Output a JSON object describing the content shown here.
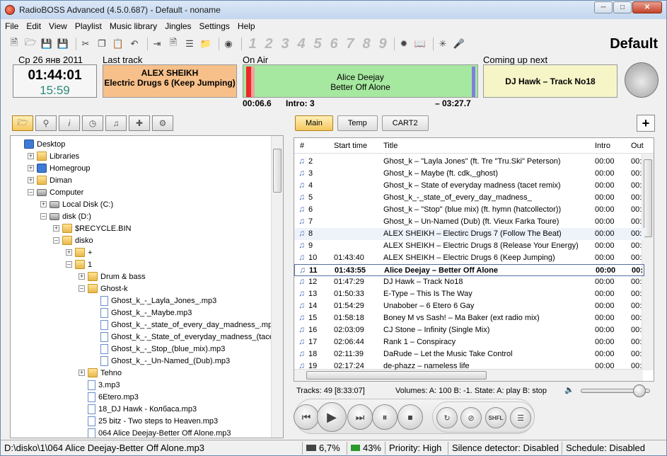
{
  "window": {
    "title": "RadioBOSS Advanced (4.5.0.687) - Default - noname",
    "profile": "Default"
  },
  "menu": [
    "File",
    "Edit",
    "View",
    "Playlist",
    "Music library",
    "Jingles",
    "Settings",
    "Help"
  ],
  "toolbar": {
    "numbers": [
      "1",
      "2",
      "3",
      "4",
      "5",
      "6",
      "7",
      "8",
      "9"
    ]
  },
  "info": {
    "date": "Ср 26 янв 2011",
    "clock_time": "01:44:01",
    "clock_sub": "15:59",
    "last_track_label": "Last track",
    "last_track": "ALEX SHEIKH\nElectric Drugs 6 (Keep Jumping)",
    "on_air_label": "On Air",
    "on_air": "Alice Deejay\nBetter Off Alone",
    "coming_next_label": "Coming up next",
    "coming_next": "DJ Hawk – Track No18",
    "elapsed": "00:06.6",
    "intro": "Intro: 3",
    "remaining": "– 03:27.7"
  },
  "tree": [
    {
      "label": "Desktop",
      "level": 0,
      "exp": "",
      "icon": "blue"
    },
    {
      "label": "Libraries",
      "level": 1,
      "exp": "+",
      "icon": "folder"
    },
    {
      "label": "Homegroup",
      "level": 1,
      "exp": "+",
      "icon": "blue"
    },
    {
      "label": "Diman",
      "level": 1,
      "exp": "+",
      "icon": "folder"
    },
    {
      "label": "Computer",
      "level": 1,
      "exp": "–",
      "icon": "drive"
    },
    {
      "label": "Local Disk (C:)",
      "level": 2,
      "exp": "+",
      "icon": "drive"
    },
    {
      "label": "disk (D:)",
      "level": 2,
      "exp": "–",
      "icon": "drive"
    },
    {
      "label": "$RECYCLE.BIN",
      "level": 3,
      "exp": "+",
      "icon": "folder"
    },
    {
      "label": "disko",
      "level": 3,
      "exp": "–",
      "icon": "folder"
    },
    {
      "label": "+",
      "level": 4,
      "exp": "+",
      "icon": "folder"
    },
    {
      "label": "1",
      "level": 4,
      "exp": "–",
      "icon": "folder"
    },
    {
      "label": "Drum & bass",
      "level": 5,
      "exp": "+",
      "icon": "folder"
    },
    {
      "label": "Ghost-k",
      "level": 5,
      "exp": "–",
      "icon": "folder"
    },
    {
      "label": "Ghost_k_-_Layla_Jones_.mp3",
      "level": 6,
      "exp": "",
      "icon": "file"
    },
    {
      "label": "Ghost_k_-_Maybe.mp3",
      "level": 6,
      "exp": "",
      "icon": "file"
    },
    {
      "label": "Ghost_k_-_state_of_every_day_madness_.mp3",
      "level": 6,
      "exp": "",
      "icon": "file"
    },
    {
      "label": "Ghost_k_-_State_of_everyday_madness_(tace",
      "level": 6,
      "exp": "",
      "icon": "file"
    },
    {
      "label": "Ghost_k_-_Stop_(blue_mix).mp3",
      "level": 6,
      "exp": "",
      "icon": "file"
    },
    {
      "label": "Ghost_k_-_Un-Named_(Dub).mp3",
      "level": 6,
      "exp": "",
      "icon": "file"
    },
    {
      "label": "Tehno",
      "level": 5,
      "exp": "+",
      "icon": "folder"
    },
    {
      "label": "3.mp3",
      "level": 5,
      "exp": "",
      "icon": "file"
    },
    {
      "label": "6Etero.mp3",
      "level": 5,
      "exp": "",
      "icon": "file"
    },
    {
      "label": "18_DJ Hawk - Колбаса.mp3",
      "level": 5,
      "exp": "",
      "icon": "file"
    },
    {
      "label": "25 bitz - Two steps to Heaven.mp3",
      "level": 5,
      "exp": "",
      "icon": "file"
    },
    {
      "label": "064 Alice Deejay-Better Off Alone.mp3",
      "level": 5,
      "exp": "",
      "icon": "file"
    }
  ],
  "tabs": [
    "Main",
    "Temp",
    "CART2"
  ],
  "playlist_header": [
    "#",
    "Start time",
    "Title",
    "Intro",
    "Out"
  ],
  "playlist": [
    {
      "n": "2",
      "start": "",
      "title": "Ghost_k – \"Layla Jones\" (ft. Tre \"Tru.Ski\" Peterson)",
      "intro": "00:00",
      "out": "00:"
    },
    {
      "n": "3",
      "start": "",
      "title": "Ghost_k – Maybe (ft. cdk,_ghost)",
      "intro": "00:00",
      "out": "00:"
    },
    {
      "n": "4",
      "start": "",
      "title": "Ghost_k – State of everyday madness (tacet remix)",
      "intro": "00:00",
      "out": "00:"
    },
    {
      "n": "5",
      "start": "",
      "title": "Ghost_k_-_state_of_every_day_madness_",
      "intro": "00:00",
      "out": "00:"
    },
    {
      "n": "6",
      "start": "",
      "title": "Ghost_k – \"Stop\" (blue mix) (ft. hymn (hatcollector))",
      "intro": "00:00",
      "out": "00:"
    },
    {
      "n": "7",
      "start": "",
      "title": "Ghost_k – Un-Named (Dub) (ft. Vieux Farka Toure)",
      "intro": "00:00",
      "out": "00:"
    },
    {
      "n": "8",
      "start": "",
      "title": "ALEX SHEIKH – Electirc Drugs 7 (Follow The Beat)",
      "intro": "00:00",
      "out": "00:"
    },
    {
      "n": "9",
      "start": "",
      "title": "ALEX SHEIKH – Electric Drugs 8 (Release Your Energy)",
      "intro": "00:00",
      "out": "00:"
    },
    {
      "n": "10",
      "start": "01:43:40",
      "title": "ALEX SHEIKH – Electric Drugs 6 (Keep Jumping)",
      "intro": "00:00",
      "out": "00:"
    },
    {
      "n": "11",
      "start": "01:43:55",
      "title": "Alice Deejay – Better Off Alone",
      "intro": "00:00",
      "out": "00:"
    },
    {
      "n": "12",
      "start": "01:47:29",
      "title": "DJ Hawk – Track No18",
      "intro": "00:00",
      "out": "00:"
    },
    {
      "n": "13",
      "start": "01:50:33",
      "title": "E-Type – This Is The Way",
      "intro": "00:00",
      "out": "00:"
    },
    {
      "n": "14",
      "start": "01:54:29",
      "title": "Unabober – 6 Etero 6 Gay",
      "intro": "00:00",
      "out": "00:"
    },
    {
      "n": "15",
      "start": "01:58:18",
      "title": "Boney M vs Sash! – Ma Baker (ext radio mix)",
      "intro": "00:00",
      "out": "00:"
    },
    {
      "n": "16",
      "start": "02:03:09",
      "title": "CJ Stone – Infinity (Single Mix)",
      "intro": "00:00",
      "out": "00:"
    },
    {
      "n": "17",
      "start": "02:06:44",
      "title": "Rank 1 – Conspiracy",
      "intro": "00:00",
      "out": "00:"
    },
    {
      "n": "18",
      "start": "02:11:39",
      "title": "DaRude – Let the Music Take Control",
      "intro": "00:00",
      "out": "00:"
    },
    {
      "n": "19",
      "start": "02:17:24",
      "title": "de-phazz – nameless life",
      "intro": "00:00",
      "out": "00:"
    }
  ],
  "playlist_status": "Tracks: 49 [8:33:07]",
  "volumes_status": "Volumes: A: 100 B: -1. State: A: play B: stop",
  "volume_level": 0.85,
  "statusbar": {
    "path": "D:\\disko\\1\\064 Alice Deejay-Better Off Alone.mp3",
    "cpu": "6,7%",
    "mem": "43%",
    "priority": "Priority: High",
    "silence": "Silence detector: Disabled",
    "schedule": "Schedule: Disabled"
  }
}
